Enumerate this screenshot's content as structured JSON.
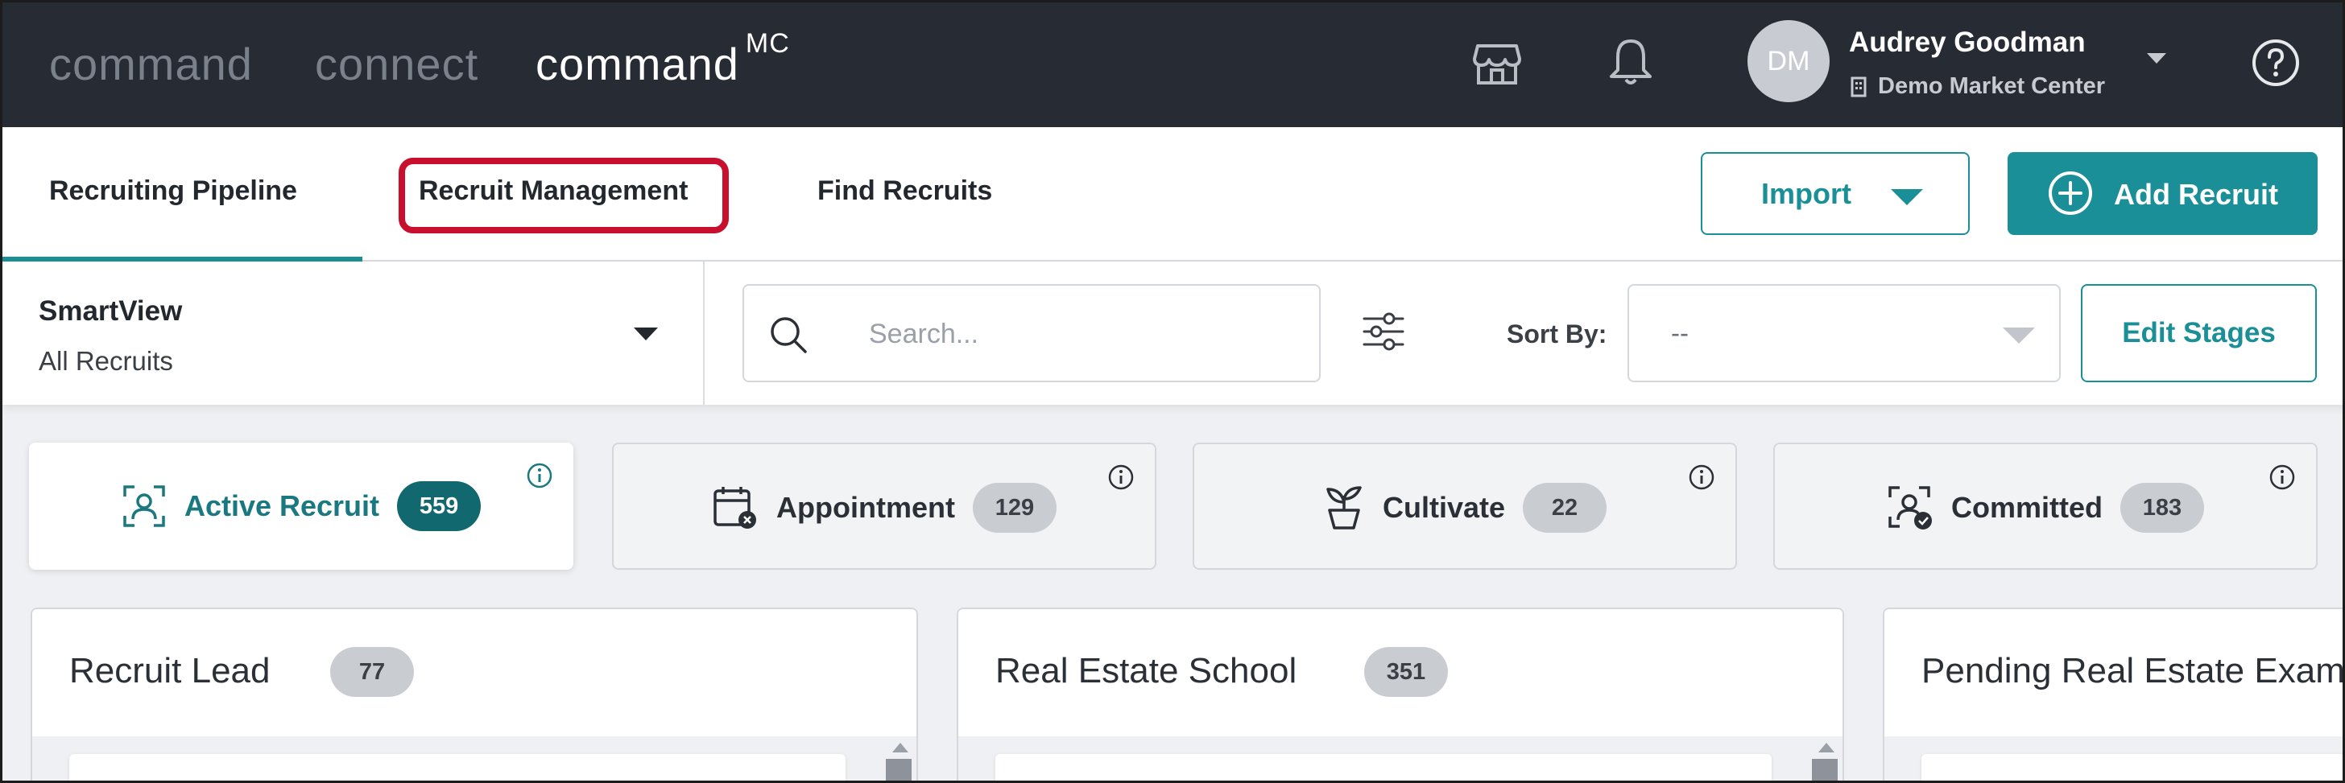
{
  "topbar": {
    "brands": [
      "command",
      "connect",
      "command"
    ],
    "brand_sup": "MC",
    "user": {
      "initials": "DM",
      "name": "Audrey Goodman",
      "market_center": "Demo Market Center"
    },
    "icons": [
      "store-icon",
      "bell-icon",
      "building-icon",
      "help-icon"
    ]
  },
  "tabs": {
    "items": [
      "Recruiting Pipeline",
      "Recruit Management",
      "Find Recruits"
    ],
    "selected": "Recruiting Pipeline",
    "highlighted": "Recruit Management"
  },
  "actions": {
    "import_label": "Import",
    "add_label": "Add Recruit"
  },
  "filters": {
    "smartview_title": "SmartView",
    "smartview_value": "All Recruits",
    "search_placeholder": "Search...",
    "sort_label": "Sort By:",
    "sort_value": "--",
    "edit_stages_label": "Edit Stages"
  },
  "stages": [
    {
      "label": "Active Recruit",
      "count": "559"
    },
    {
      "label": "Appointment",
      "count": "129"
    },
    {
      "label": "Cultivate",
      "count": "22"
    },
    {
      "label": "Committed",
      "count": "183"
    }
  ],
  "columns": [
    {
      "title": "Recruit Lead",
      "count": "77"
    },
    {
      "title": "Real Estate School",
      "count": "351"
    },
    {
      "title": "Pending Real Estate Exam"
    }
  ],
  "colors": {
    "accent": "#1a8f97",
    "accent_dark": "#11686f",
    "topbar": "#272b33",
    "highlight": "#c8102e"
  }
}
